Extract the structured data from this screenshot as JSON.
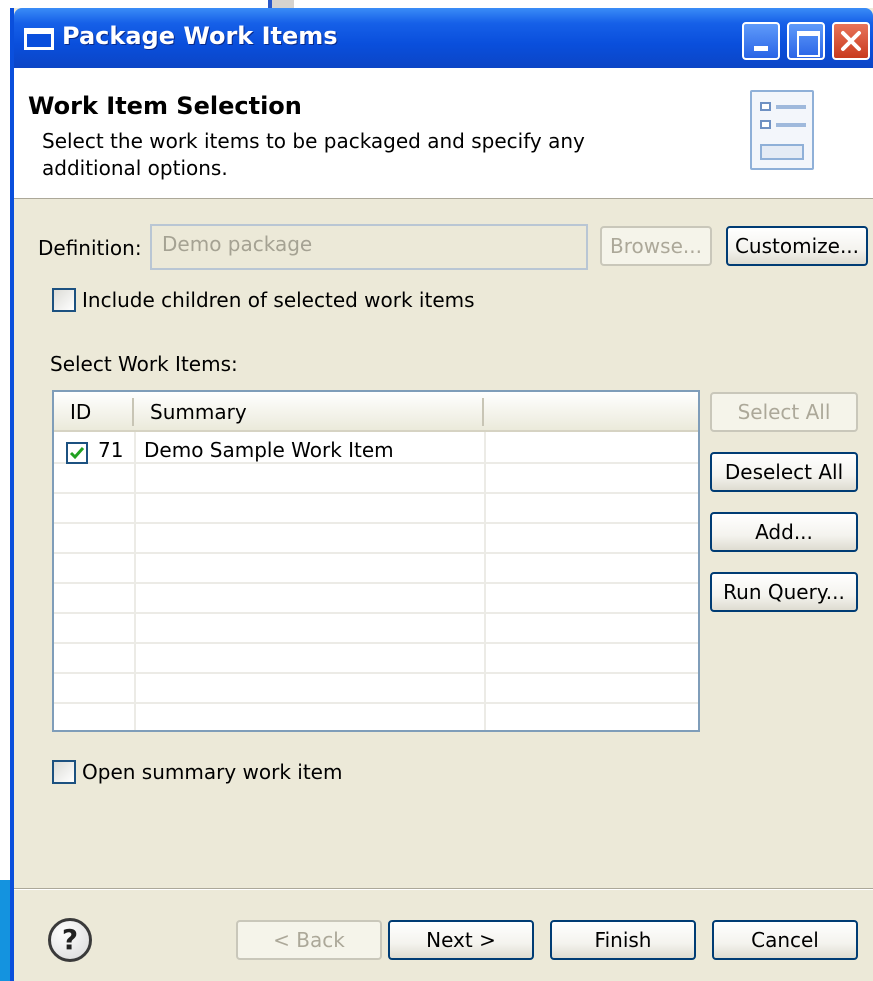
{
  "window": {
    "title": "Package Work Items"
  },
  "header": {
    "title": "Work Item Selection",
    "description": "Select the work items to be packaged and specify any additional options."
  },
  "definition": {
    "label": "Definition:",
    "value": "Demo package",
    "browse_label": "Browse...",
    "customize_label": "Customize..."
  },
  "include_children": {
    "label": "Include children of selected work items",
    "checked": false
  },
  "work_items": {
    "label": "Select Work Items:",
    "columns": [
      "ID",
      "Summary",
      ""
    ],
    "rows": [
      {
        "checked": true,
        "id": "71",
        "summary": "Demo Sample Work Item"
      }
    ]
  },
  "side_buttons": {
    "select_all": "Select All",
    "deselect_all": "Deselect All",
    "add": "Add...",
    "run_query": "Run Query..."
  },
  "open_summary": {
    "label": "Open summary work item",
    "checked": false
  },
  "footer": {
    "help_glyph": "?",
    "back": "< Back",
    "next": "Next >",
    "finish": "Finish",
    "cancel": "Cancel"
  },
  "colors": {
    "titlebar": "#0a4fdc",
    "dialog_bg": "#ece9d8",
    "button_border": "#003c74",
    "check_green": "#21a121"
  },
  "icons": {
    "window": "window-icon",
    "minimize": "minimize-icon",
    "maximize": "maximize-icon",
    "close": "close-icon",
    "header": "form-list-icon",
    "help": "help-icon",
    "check": "checkmark-icon"
  }
}
